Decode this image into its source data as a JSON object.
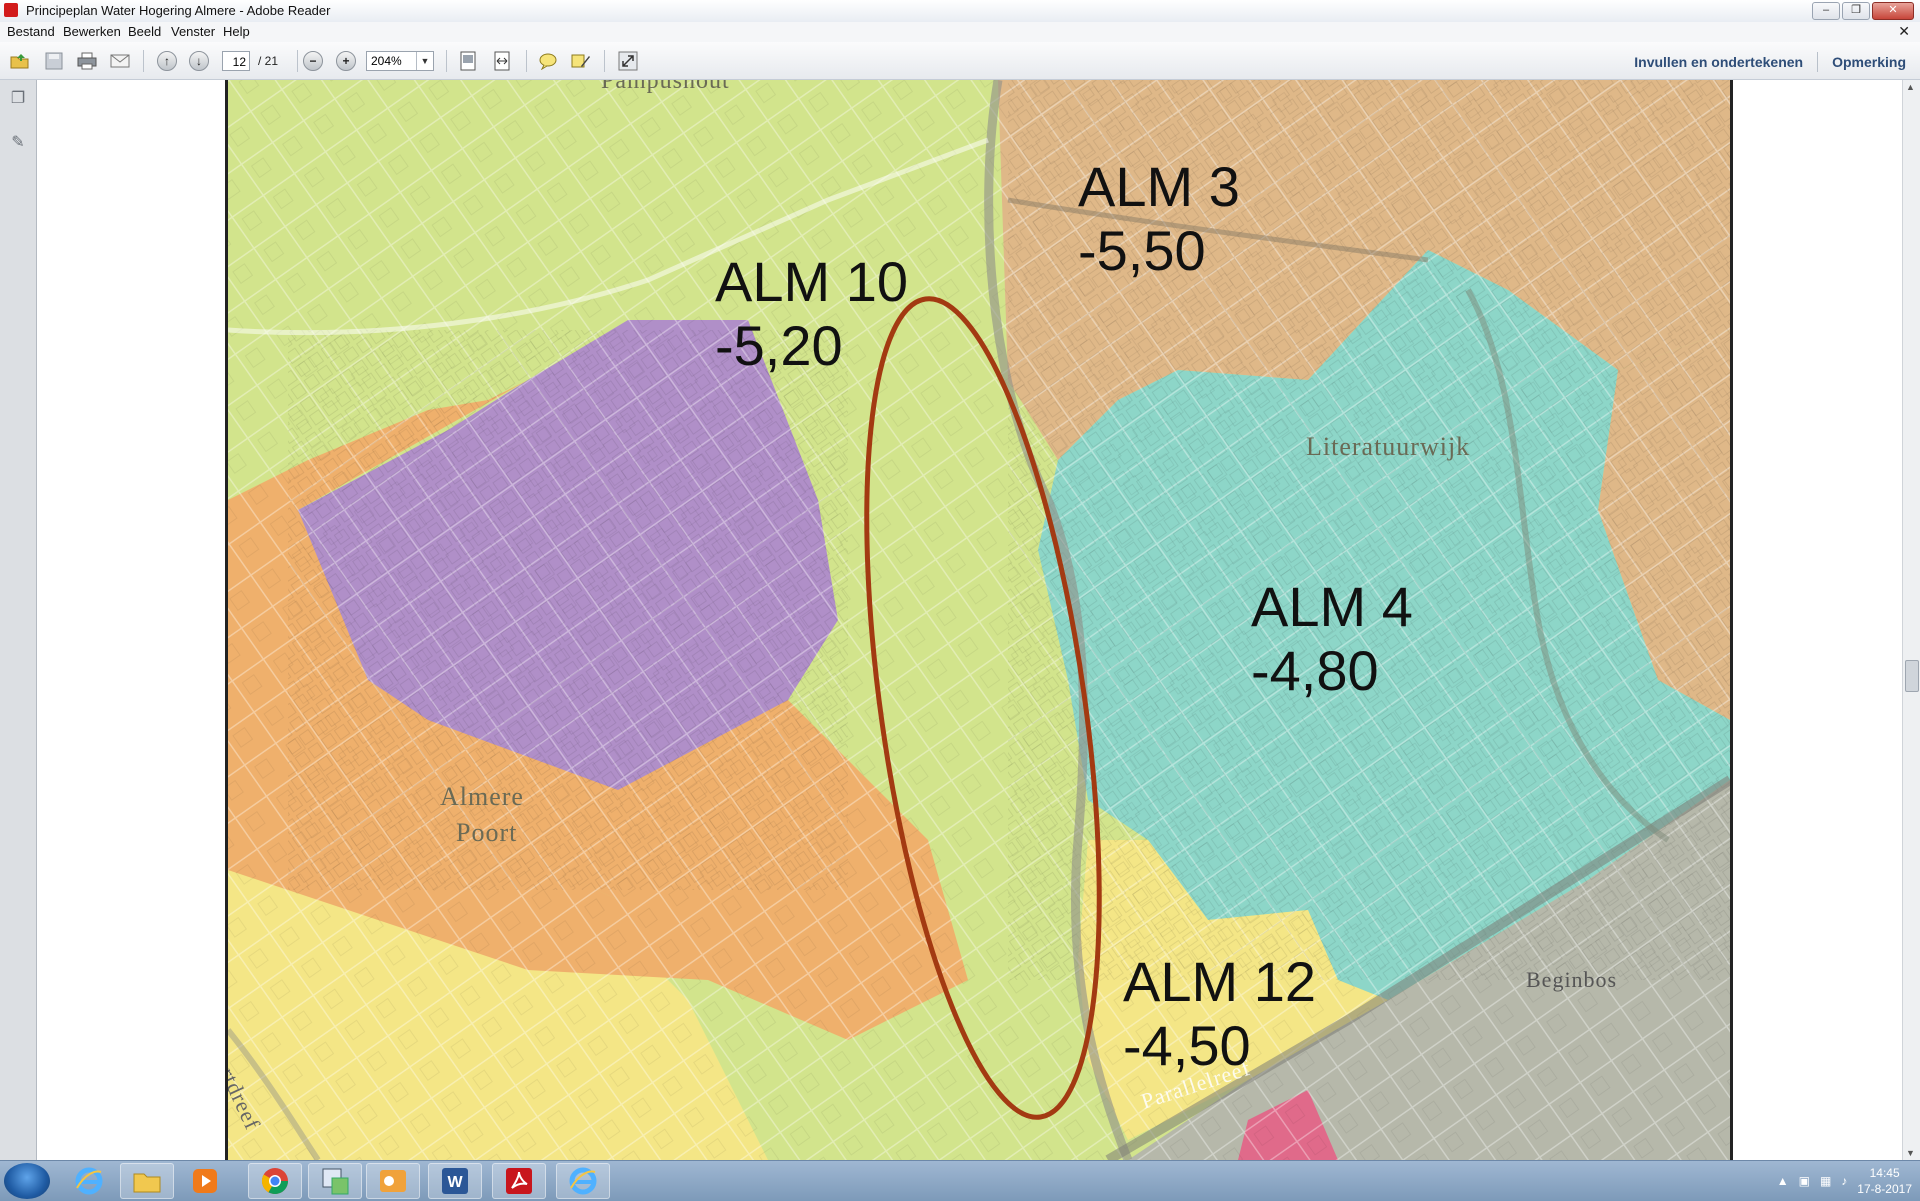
{
  "window": {
    "title": "Principeplan Water Hogering Almere - Adobe Reader"
  },
  "menu": {
    "items": [
      "Bestand",
      "Bewerken",
      "Beeld",
      "Venster",
      "Help"
    ]
  },
  "toolbar": {
    "page_current": "12",
    "page_total": "/ 21",
    "zoom": "204%",
    "fill_sign": "Invullen en ondertekenen",
    "comment": "Opmerking"
  },
  "map": {
    "labels": {
      "pampus": "Pampushout",
      "literatuurwijk": "Literatuurwijk",
      "almere": "Almere",
      "poort": "Poort",
      "beginbos": "Beginbos",
      "parallel": "Parallelreef",
      "portdreef": "Poortdreef"
    },
    "zones": [
      {
        "name": "ALM 3",
        "level": "-5,50",
        "color": "#d9b27e"
      },
      {
        "name": "ALM 10",
        "level": "-5,20",
        "color": "#c8de7e"
      },
      {
        "name": "ALM 4",
        "level": "-4,80",
        "color": "#7fd3c4"
      },
      {
        "name": "ALM 12",
        "level": "-4,50",
        "color": "#f4e47c"
      }
    ],
    "ellipse_color": "#a33a12"
  },
  "taskbar": {
    "time": "14:45",
    "date": "17-8-2017"
  }
}
